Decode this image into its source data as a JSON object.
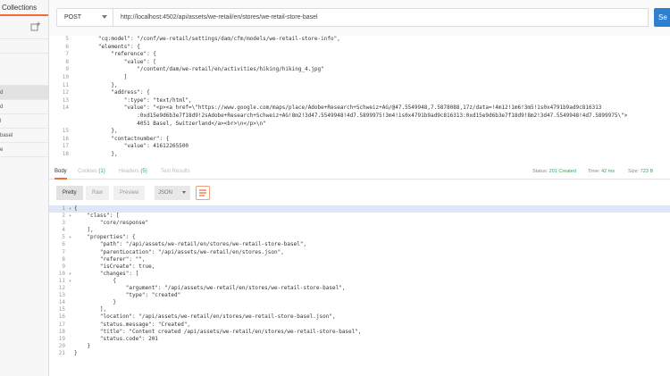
{
  "sidebar": {
    "tab_label": "Collections",
    "items": [
      {
        "label": ""
      },
      {
        "label": "d"
      },
      {
        "label": "d"
      },
      {
        "label": "l"
      },
      {
        "label": "basel"
      },
      {
        "label": "e"
      }
    ],
    "selected_index": 1
  },
  "request": {
    "method": "POST",
    "url": "http://localhost:4502/api/assets/we-retail/en/stores/we-retail-store-basel",
    "send_label": "Se"
  },
  "request_body": {
    "lines": [
      {
        "n": "5",
        "t": "        \"cq:model\": \"/conf/we-retail/settings/dam/cfm/models/we-retail-store-info\","
      },
      {
        "n": "6",
        "t": "        \"elements\": {"
      },
      {
        "n": "7",
        "t": "            \"reference\": {"
      },
      {
        "n": "8",
        "t": "                \"value\": ["
      },
      {
        "n": "9",
        "t": "                    \"/content/dam/we-retail/en/activities/hiking/hiking_4.jpg\""
      },
      {
        "n": "10",
        "t": "                ]"
      },
      {
        "n": "11",
        "t": "            },"
      },
      {
        "n": "12",
        "t": "            \"address\": {"
      },
      {
        "n": "13",
        "t": "                \":type\": \"text/html\","
      },
      {
        "n": "14",
        "t": "                \"value\": \"<p><a href=\\\"https://www.google.com/maps/place/Adobe+Research+Schweiz+AG/@47.5549948,7.5878088,17z/data=!4m12!1m6!3m5!1s0x4791b9ad9c816313"
      },
      {
        "n": "",
        "t": "                    :0xd15e9d6b3e7f18d9!2sAdobe+Research+Schweiz+AG!8m2!3d47.5549948!4d7.5899975!3m4!1s0x4791b9ad9c816313:0xd15e9d6b3e7f18d9!8m2!3d47.5549948!4d7.5899975\\\">"
      },
      {
        "n": "",
        "t": "                    4051 Basel, Switzerland</a><br>\\n</p>\\n\""
      },
      {
        "n": "15",
        "t": "            },"
      },
      {
        "n": "16",
        "t": "            \"contactnumber\": {"
      },
      {
        "n": "17",
        "t": "                \"value\": 41612265500"
      },
      {
        "n": "18",
        "t": "            },"
      }
    ]
  },
  "response_tabs": [
    {
      "label": "Body",
      "count": ""
    },
    {
      "label": "Cookies",
      "count": "(1)"
    },
    {
      "label": "Headers",
      "count": "(5)"
    },
    {
      "label": "Test Results",
      "count": ""
    }
  ],
  "response_meta": {
    "status_label": "Status:",
    "status_value": "201 Created",
    "time_label": "Time:",
    "time_value": "42 ms",
    "size_label": "Size:",
    "size_value": "723 B"
  },
  "format_toolbar": {
    "pretty": "Pretty",
    "raw": "Raw",
    "preview": "Preview",
    "json": "JSON"
  },
  "response_body": {
    "lines": [
      {
        "n": "1",
        "f": "▾",
        "t": "{",
        "hl": true
      },
      {
        "n": "2",
        "f": "▾",
        "t": "    \"class\": ["
      },
      {
        "n": "3",
        "f": "",
        "t": "        \"core/response\""
      },
      {
        "n": "4",
        "f": "",
        "t": "    ],"
      },
      {
        "n": "5",
        "f": "▾",
        "t": "    \"properties\": {"
      },
      {
        "n": "6",
        "f": "",
        "t": "        \"path\": \"/api/assets/we-retail/en/stores/we-retail-store-basel\","
      },
      {
        "n": "7",
        "f": "",
        "t": "        \"parentLocation\": \"/api/assets/we-retail/en/stores.json\","
      },
      {
        "n": "8",
        "f": "",
        "t": "        \"referer\": \"\","
      },
      {
        "n": "9",
        "f": "",
        "t": "        \"isCreate\": true,"
      },
      {
        "n": "10",
        "f": "▾",
        "t": "        \"changes\": ["
      },
      {
        "n": "11",
        "f": "▾",
        "t": "            {"
      },
      {
        "n": "12",
        "f": "",
        "t": "                \"argument\": \"/api/assets/we-retail/en/stores/we-retail-store-basel\","
      },
      {
        "n": "13",
        "f": "",
        "t": "                \"type\": \"created\""
      },
      {
        "n": "14",
        "f": "",
        "t": "            }"
      },
      {
        "n": "15",
        "f": "",
        "t": "        ],"
      },
      {
        "n": "16",
        "f": "",
        "t": "        \"location\": \"/api/assets/we-retail/en/stores/we-retail-store-basel.json\","
      },
      {
        "n": "17",
        "f": "",
        "t": "        \"status.message\": \"Created\","
      },
      {
        "n": "18",
        "f": "",
        "t": "        \"title\": \"Content created /api/assets/we-retail/en/stores/we-retail-store-basel\","
      },
      {
        "n": "19",
        "f": "",
        "t": "        \"status.code\": 201"
      },
      {
        "n": "20",
        "f": "",
        "t": "    }"
      },
      {
        "n": "21",
        "f": "",
        "t": "}"
      }
    ]
  },
  "colors": {
    "accent": "#f26b3a",
    "send_button": "#2f7fd1",
    "status_ok": "#3fa05e"
  }
}
